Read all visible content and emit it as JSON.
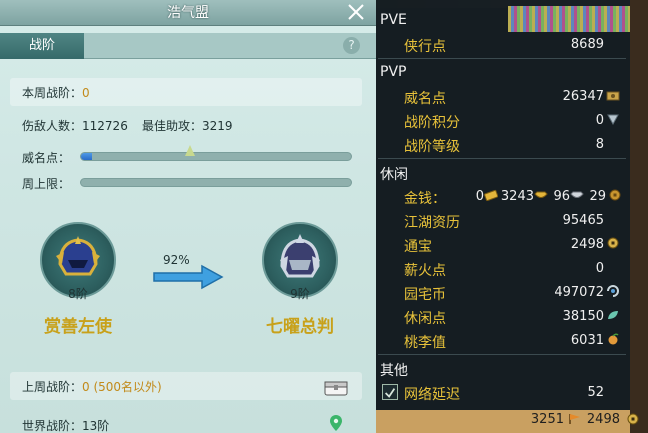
{
  "window": {
    "title": "浩气盟"
  },
  "tabs": [
    {
      "label": "战阶"
    }
  ],
  "help_label": "?",
  "week_rank": {
    "label": "本周战阶：",
    "value": "0"
  },
  "kills": {
    "label": "伤敌人数：",
    "value": "112726"
  },
  "best_assist": {
    "label": "最佳助攻：",
    "value": "3219"
  },
  "prestige_bar": {
    "label": "威名点：",
    "fill": 0.04
  },
  "weekly_cap_bar": {
    "label": "周上限：",
    "fill": 0.0
  },
  "current_medal": {
    "tier": "8阶",
    "name": "赏善左使"
  },
  "next_medal": {
    "tier": "9阶",
    "name": "七曜总判"
  },
  "progress": {
    "percent_label": "92%",
    "value": 0.92
  },
  "last_week": {
    "label": "上周战阶：",
    "value": "0 (500名以外)"
  },
  "world_rank": {
    "label": "世界战阶：",
    "value": "13阶"
  },
  "stats": {
    "pve": {
      "header": "PVE",
      "rows": [
        {
          "label": "侠行点",
          "value": "8689"
        }
      ]
    },
    "pvp": {
      "header": "PVP",
      "rows": [
        {
          "label": "威名点",
          "value": "26347"
        },
        {
          "label": "战阶积分",
          "value": "0"
        },
        {
          "label": "战阶等级",
          "value": "8"
        }
      ]
    },
    "leisure": {
      "header": "休闲",
      "money": {
        "label": "金钱：",
        "gold_brick": "0",
        "gold": "3243",
        "silver": "96",
        "copper": "29"
      },
      "rows": [
        {
          "label": "江湖资历",
          "value": "95465"
        },
        {
          "label": "通宝",
          "value": "2498"
        },
        {
          "label": "薪火点",
          "value": "0"
        },
        {
          "label": "园宅币",
          "value": "497072"
        },
        {
          "label": "休闲点",
          "value": "38150"
        },
        {
          "label": "桃李值",
          "value": "6031"
        }
      ]
    },
    "other": {
      "header": "其他",
      "ping": {
        "label": "网络延迟",
        "value": "52"
      }
    }
  },
  "bottom_bar": {
    "coin_a": "3251",
    "coin_b": "2498"
  },
  "colors": {
    "accent_gold": "#e8c23a",
    "panel_teal": "#cfe6e3",
    "medal_name": "#c8a11a"
  }
}
